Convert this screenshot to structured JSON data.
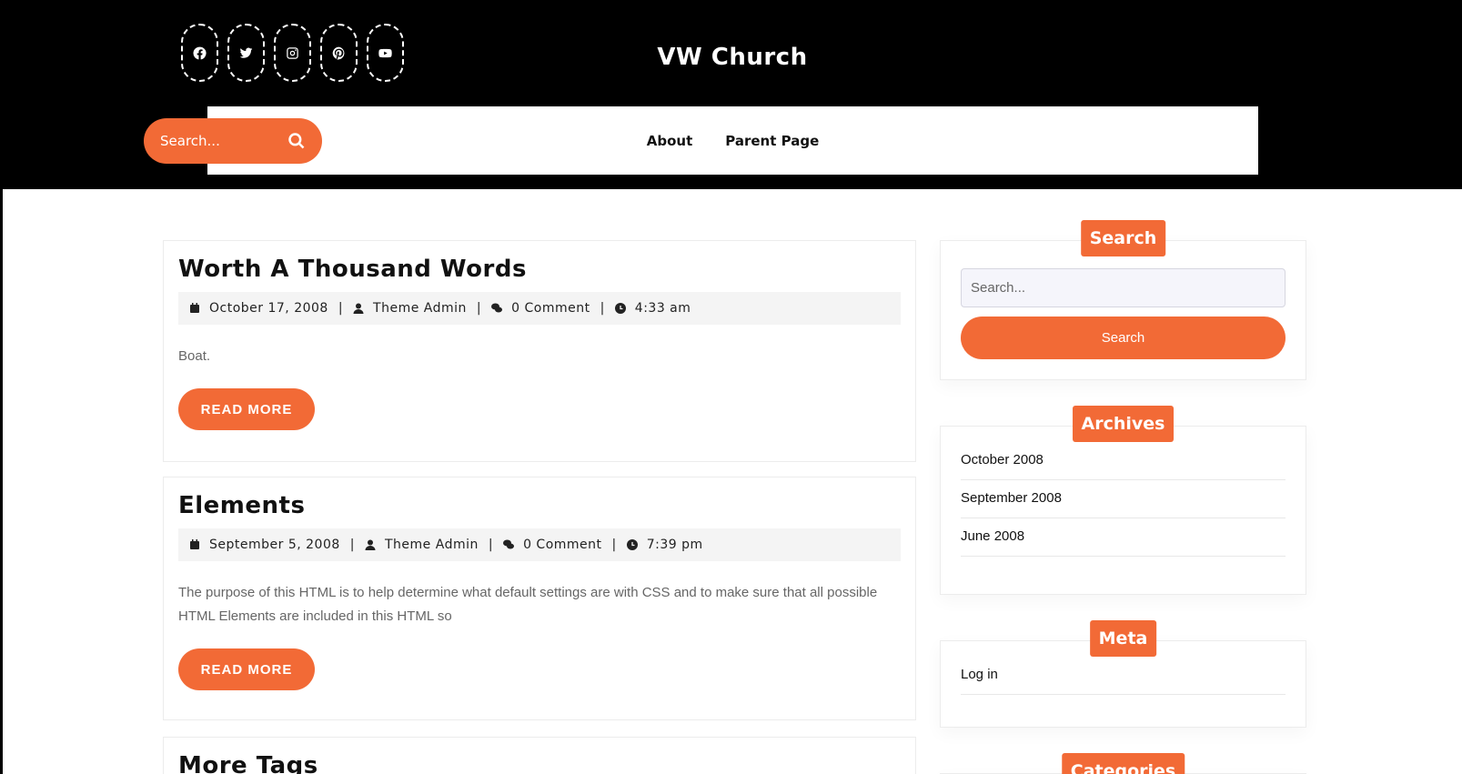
{
  "header": {
    "site_title": "VW Church",
    "socials": [
      {
        "name": "facebook-icon"
      },
      {
        "name": "twitter-icon"
      },
      {
        "name": "instagram-icon"
      },
      {
        "name": "pinterest-icon"
      },
      {
        "name": "youtube-icon"
      }
    ],
    "search_placeholder": "Search...",
    "nav": [
      "About",
      "Parent Page"
    ]
  },
  "posts": [
    {
      "title": "Worth A Thousand Words",
      "date": "October 17, 2008",
      "author": "Theme Admin",
      "comments": "0 Comment",
      "time": "4:33 am",
      "excerpt": "Boat.",
      "read_more": "READ MORE"
    },
    {
      "title": "Elements",
      "date": "September 5, 2008",
      "author": "Theme Admin",
      "comments": "0 Comment",
      "time": "7:39 pm",
      "excerpt": "The purpose of this HTML is to help determine what default settings are with CSS and to make sure that all possible HTML Elements are included in this HTML so",
      "read_more": "READ MORE"
    },
    {
      "title": "More Tags"
    }
  ],
  "sidebar": {
    "search": {
      "title": "Search",
      "placeholder": "Search...",
      "button": "Search"
    },
    "archives": {
      "title": "Archives",
      "items": [
        "October 2008",
        "September 2008",
        "June 2008"
      ]
    },
    "meta": {
      "title": "Meta",
      "items": [
        "Log in"
      ]
    },
    "categories": {
      "title": "Categories"
    }
  },
  "colors": {
    "accent": "#f26a36",
    "header_bg": "#000000"
  }
}
